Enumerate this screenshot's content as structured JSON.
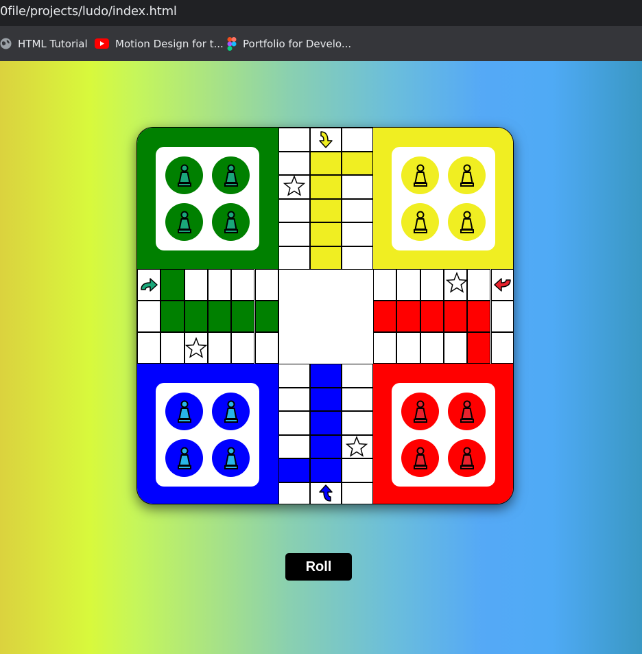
{
  "browser": {
    "url": "0file/projects/ludo/index.html",
    "bookmarks": [
      {
        "label": "HTML Tutorial",
        "icon": "globe-icon"
      },
      {
        "label": "Motion Design for t...",
        "icon": "youtube-icon"
      },
      {
        "label": "Portfolio for Develo...",
        "icon": "figma-icon"
      }
    ]
  },
  "colors": {
    "green": "#008000",
    "yellow": "#f0ee22",
    "blue": "#0000ff",
    "red": "#ff0000",
    "green_pawn": "#1aa77a",
    "yellow_pawn": "#f0ee22",
    "blue_pawn": "#29b6e8",
    "red_pawn": "#e8232e"
  },
  "board": {
    "bases": [
      {
        "color": "green",
        "pieces": 4
      },
      {
        "color": "yellow",
        "pieces": 4
      },
      {
        "color": "blue",
        "pieces": 4
      },
      {
        "color": "red",
        "pieces": 4
      }
    ],
    "safe_spots": 4,
    "start_arrows": [
      "green",
      "yellow",
      "blue",
      "red"
    ]
  },
  "controls": {
    "roll_label": "Roll"
  }
}
